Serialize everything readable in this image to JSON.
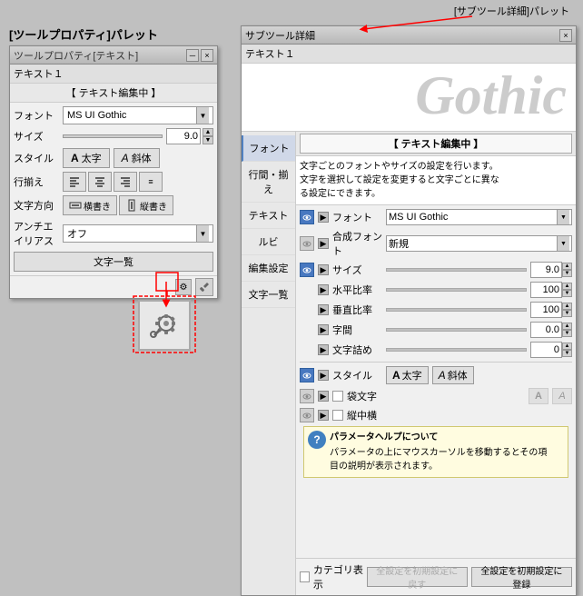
{
  "labels": {
    "tool_props_label": "[ツールプロパティ]パレット",
    "sub_tool_label": "[サブツール詳細]パレット",
    "sub_tool_title": "サブツール詳細"
  },
  "tool_props": {
    "title": "ツールプロパティ[テキスト]",
    "tab": "テキスト１",
    "section_header": "【 テキスト編集中 】",
    "font_label": "フォント",
    "font_value": "MS UI Gothic",
    "size_label": "サイズ",
    "size_value": "9.0",
    "style_label": "スタイル",
    "bold_label": "太字",
    "italic_label": "斜体",
    "align_label": "行揃え",
    "direction_label": "文字方向",
    "direction_h": "横書き",
    "direction_v": "縦書き",
    "antialias_label": "アンチエイリアス",
    "antialias_value": "オフ",
    "char_list_label": "文字一覧"
  },
  "sub_tool": {
    "title": "サブツール詳細",
    "tab": "テキスト１",
    "section_header": "【 テキスト編集中 】",
    "description": "文字ごとのフォントやサイズの設定を行います。\n文字を選択して設定を変更すると文字ごとに異な\nる設定にできます。",
    "nav_items": [
      "フォント",
      "行間・揃え",
      "テキスト",
      "ルビ",
      "編集設定",
      "文字一覧"
    ],
    "font_label": "フォント",
    "font_value": "MS UI Gothic",
    "composite_font_label": "合成フォント",
    "composite_font_value": "新規",
    "size_label": "サイズ",
    "size_value": "9.0",
    "h_scale_label": "水平比率",
    "h_scale_value": "100",
    "v_scale_label": "垂直比率",
    "v_scale_value": "100",
    "char_space_label": "字間",
    "char_space_value": "0.0",
    "char_squeeze_label": "文字詰め",
    "char_squeeze_value": "0",
    "style_label": "スタイル",
    "bold_label": "太字",
    "italic_label": "斜体",
    "outline_label": "袋文字",
    "vertical_center_label": "縦中横",
    "help_title": "パラメータヘルプについて",
    "help_text": "パラメータの上にマウスカーソルを移動するとその項\n目の説明が表示されます。",
    "category_label": "カテゴリ表示",
    "reset_all_label": "全設定を初期設定に戻す",
    "register_label": "全設定を初期設定に登録",
    "gothic_text": "Gothic"
  }
}
